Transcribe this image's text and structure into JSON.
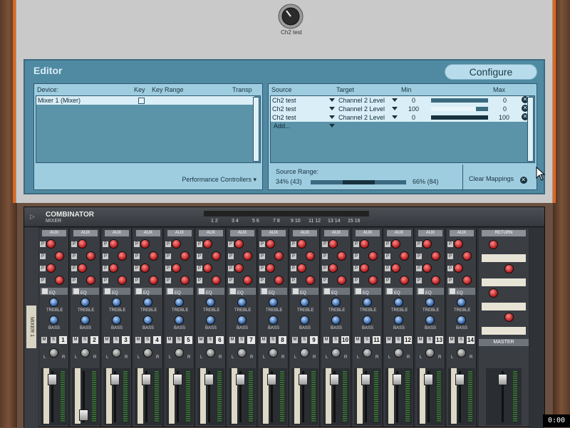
{
  "combinator": {
    "rotary_label": "Ch2 test"
  },
  "editor": {
    "title": "Editor",
    "configure_label": "Configure",
    "device_headers": {
      "device": "Device:",
      "key": "Key",
      "key_range": "Key Range",
      "transp": "Transp"
    },
    "devices": [
      {
        "name": "Mixer 1 (Mixer)"
      }
    ],
    "performance_controllers": "Performance Controllers",
    "mapping_headers": {
      "source": "Source",
      "target": "Target",
      "min": "Min",
      "max": "Max"
    },
    "mappings": [
      {
        "source": "Ch2 test",
        "target": "Channel 2 Level",
        "min": "0",
        "max": "0",
        "slider_from": 0.0,
        "slider_to": 0.0
      },
      {
        "source": "Ch2 test",
        "target": "Channel 2 Level",
        "min": "100",
        "max": "0",
        "slider_from": 0.0,
        "slider_to": 0.79
      },
      {
        "source": "Ch2 test",
        "target": "Channel 2 Level",
        "min": "0",
        "max": "100",
        "slider_from": 0.0,
        "slider_to": 0.79
      }
    ],
    "add_label": "Add...",
    "source_range_label": "Source Range:",
    "source_range_from": "34% (43)",
    "source_range_to": "66% (84)",
    "clear_mappings": "Clear Mappings"
  },
  "mixer": {
    "name": "COMBINATOR",
    "subname": "MIXER",
    "device_label": "MIXER 1",
    "led_labels": [
      "1 2",
      "3 4",
      "5 6",
      "7 8",
      "9 10",
      "11 12",
      "13 14",
      "15 16"
    ],
    "aux_label": "AUX",
    "eq_label": "EQ",
    "treble_label": "TREBLE",
    "bass_label": "BASS",
    "return_label": "RETURN",
    "master_label": "MASTER",
    "channels": [
      "1",
      "2",
      "3",
      "4",
      "5",
      "6",
      "7",
      "8",
      "9",
      "10",
      "11",
      "12",
      "13",
      "14"
    ]
  },
  "status": {
    "timecode": "0:00"
  }
}
